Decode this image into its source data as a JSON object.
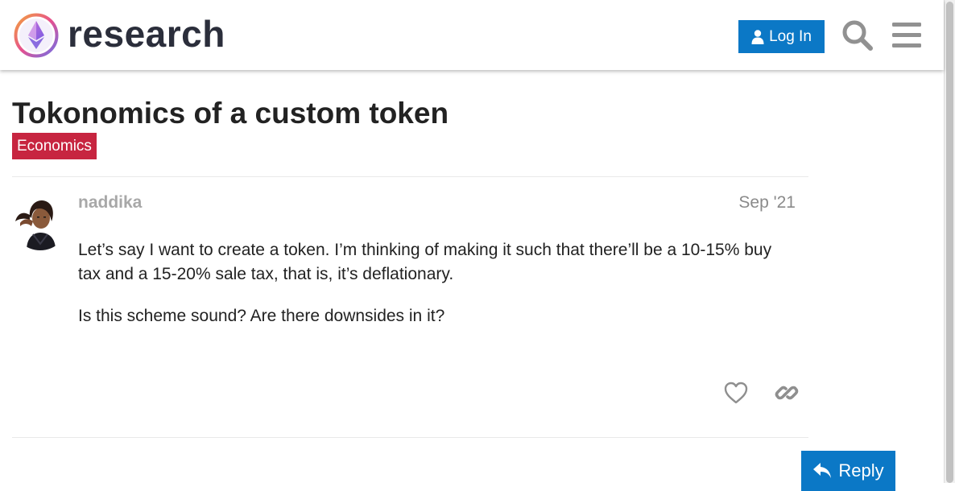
{
  "header": {
    "site_name": "research",
    "login_label": "Log In",
    "icons": [
      "ethereum-logo-icon",
      "user-icon",
      "search-icon",
      "hamburger-menu-icon"
    ]
  },
  "topic": {
    "title": "Tokonomics of a custom token",
    "category": "Economics",
    "category_color": "#c72540"
  },
  "post": {
    "username": "naddika",
    "date": "Sep '21",
    "paragraphs": [
      "Let’s say I want to create a token. I’m thinking of making it such that there’ll be a 10-15% buy tax and a 15-20% sale tax, that is, it’s deflationary.",
      "Is this scheme sound? Are there downsides in it?"
    ],
    "actions": [
      "heart-icon",
      "link-icon"
    ]
  },
  "footer": {
    "reply_label": "Reply"
  },
  "colors": {
    "accent": "#0b78c6",
    "text": "#222222",
    "muted": "#a8a8a8"
  }
}
